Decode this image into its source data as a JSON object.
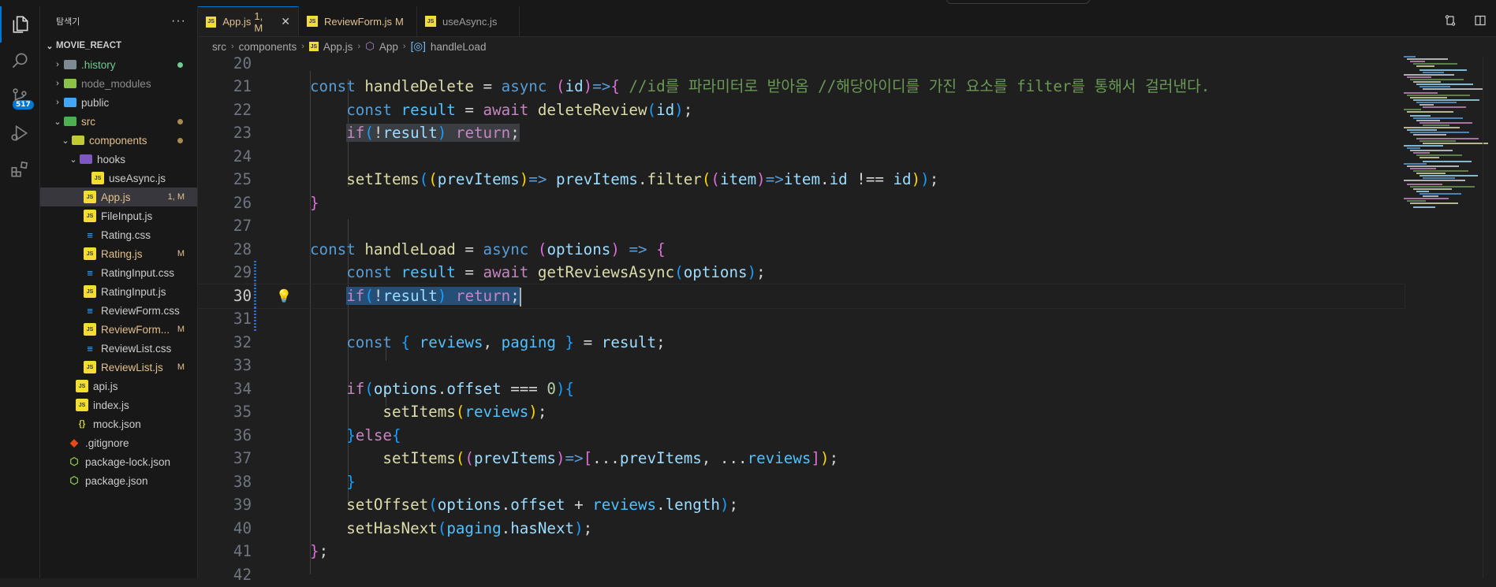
{
  "sidebar": {
    "title": "탐색기",
    "more_label": "···",
    "project": "MOVIE_REACT",
    "items": [
      {
        "label": ".history"
      },
      {
        "label": "node_modules"
      },
      {
        "label": "public"
      },
      {
        "label": "src"
      },
      {
        "label": "components"
      },
      {
        "label": "hooks"
      },
      {
        "label": "useAsync.js"
      },
      {
        "label": "App.js",
        "decoration": "1, M"
      },
      {
        "label": "FileInput.js"
      },
      {
        "label": "Rating.css"
      },
      {
        "label": "Rating.js",
        "decoration": "M"
      },
      {
        "label": "RatingInput.css"
      },
      {
        "label": "RatingInput.js"
      },
      {
        "label": "ReviewForm.css"
      },
      {
        "label": "ReviewForm...",
        "decoration": "M"
      },
      {
        "label": "ReviewList.css"
      },
      {
        "label": "ReviewList.js",
        "decoration": "M"
      },
      {
        "label": "api.js"
      },
      {
        "label": "index.js"
      },
      {
        "label": "mock.json"
      },
      {
        "label": ".gitignore"
      },
      {
        "label": "package-lock.json"
      },
      {
        "label": "package.json"
      }
    ]
  },
  "activity": {
    "source_control_badge": "517"
  },
  "tabs": [
    {
      "label": "App.js",
      "decoration": "1, M",
      "close": "✕"
    },
    {
      "label": "ReviewForm.js",
      "decoration": "M"
    },
    {
      "label": "useAsync.js"
    }
  ],
  "breadcrumb": [
    "src",
    "components",
    "App.js",
    "App",
    "handleLoad"
  ],
  "editor": {
    "line_numbers": [
      "20",
      "21",
      "22",
      "23",
      "24",
      "25",
      "26",
      "27",
      "28",
      "29",
      "30",
      "31",
      "32",
      "33",
      "34",
      "35",
      "36",
      "37",
      "38",
      "39",
      "40",
      "41",
      "42"
    ],
    "comment_line_21": "//id를 파라미터로 받아옴 //해당아이디를 가진 요소를 filter를 통해서 걸러낸다."
  },
  "colors": {
    "accent": "#0078d4",
    "modified": "#e2c08d",
    "selection": "#264f78"
  }
}
